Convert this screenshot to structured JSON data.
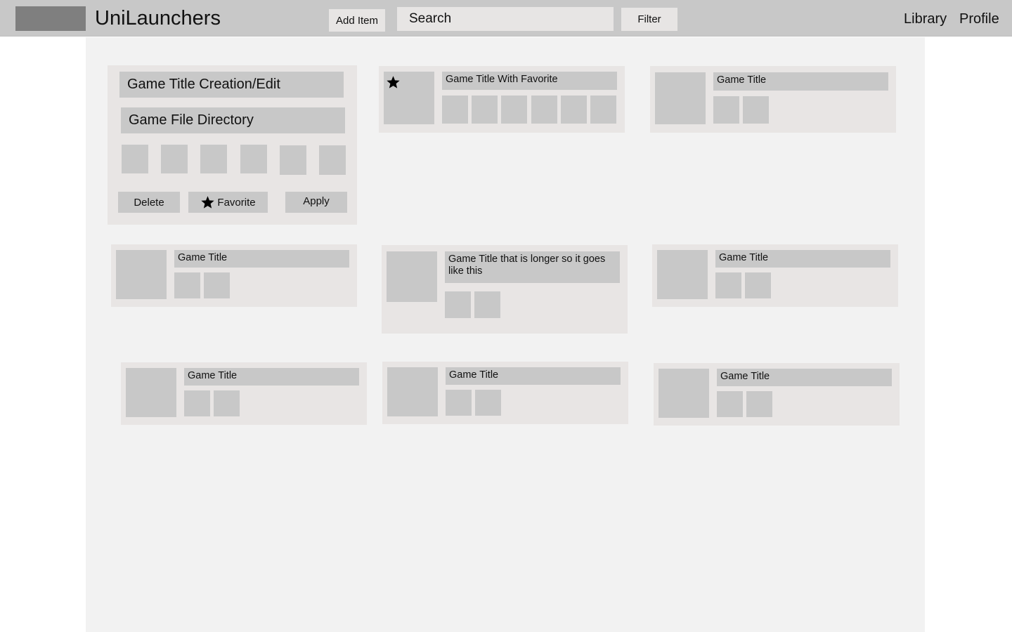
{
  "header": {
    "app_title": "UniLaunchers",
    "add_item_label": "Add Item",
    "search_placeholder": "Search",
    "filter_label": "Filter",
    "nav": {
      "library": "Library",
      "profile": "Profile"
    }
  },
  "editor": {
    "title_field": "Game Title Creation/Edit",
    "directory_field": "Game File Directory",
    "delete_label": "Delete",
    "favorite_label": "Favorite",
    "apply_label": "Apply"
  },
  "cards": [
    {
      "title": "Game Title With Favorite",
      "favorite": true
    },
    {
      "title": "Game Title",
      "favorite": false
    },
    {
      "title": "Game Title",
      "favorite": false
    },
    {
      "title": "Game Title that is longer so it goes like this",
      "favorite": false
    },
    {
      "title": "Game Title",
      "favorite": false
    },
    {
      "title": "Game Title",
      "favorite": false
    },
    {
      "title": "Game Title",
      "favorite": false
    },
    {
      "title": "Game Title",
      "favorite": false
    }
  ],
  "icons": {
    "favorite": "star-icon",
    "logo": "logo-placeholder"
  },
  "colors": {
    "header": "#c8c8c8",
    "content": "#f2f2f2",
    "card": "#e8e5e4",
    "placeholder": "#c8c8c8",
    "logo": "#7f7f7f"
  }
}
